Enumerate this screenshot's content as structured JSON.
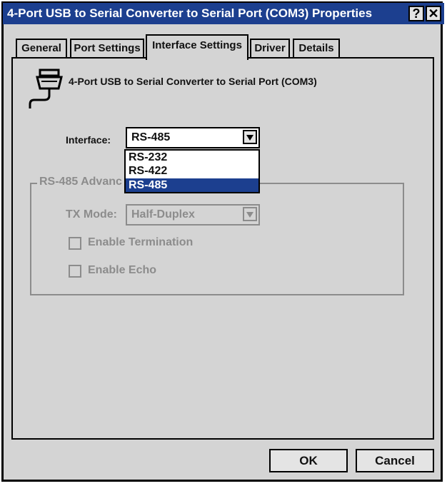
{
  "window": {
    "title": "4-Port USB to Serial Converter to Serial Port (COM3) Properties",
    "help_label": "?",
    "close_label": "✕"
  },
  "tabs": [
    {
      "label": "General"
    },
    {
      "label": "Port Settings"
    },
    {
      "label": "Interface Settings",
      "active": true
    },
    {
      "label": "Driver"
    },
    {
      "label": "Details"
    }
  ],
  "device": {
    "name": "4-Port USB to Serial Converter to Serial Port (COM3)",
    "icon": "serial-port-icon"
  },
  "interface": {
    "label": "Interface:",
    "value": "RS-485",
    "options": [
      "RS-232",
      "RS-422",
      "RS-485"
    ],
    "selected_option": "RS-485"
  },
  "advanced": {
    "group_label": "RS-485 Advanc",
    "tx_mode_label": "TX Mode:",
    "tx_mode_value": "Half-Duplex",
    "enable_termination_label": "Enable Termination",
    "enable_termination_checked": false,
    "enable_echo_label": "Enable Echo",
    "enable_echo_checked": false
  },
  "buttons": {
    "ok": "OK",
    "cancel": "Cancel"
  },
  "colors": {
    "titlebar": "#1c3f8f",
    "selection": "#1c3f8f",
    "dialog_bg": "#d4d4d4",
    "disabled_text": "#8c8c8c"
  }
}
